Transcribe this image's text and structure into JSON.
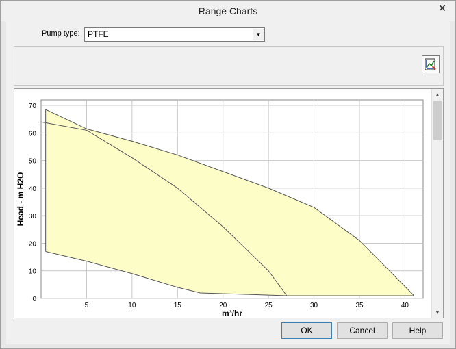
{
  "window": {
    "title": "Range Charts",
    "close_glyph": "✕"
  },
  "form": {
    "pump_type_label": "Pump type:",
    "pump_type_value": "PTFE"
  },
  "toolbar": {
    "chart_tool_icon": "chart-settings-icon"
  },
  "buttons": {
    "ok": "OK",
    "cancel": "Cancel",
    "help": "Help"
  },
  "chart_data": {
    "type": "area",
    "xlabel": "m³/hr",
    "ylabel": "Head - m H2O",
    "xlim": [
      0,
      42
    ],
    "ylim": [
      0,
      72
    ],
    "x_ticks": [
      5,
      10,
      15,
      20,
      25,
      30,
      35,
      40
    ],
    "y_ticks": [
      0,
      10,
      20,
      30,
      40,
      50,
      60,
      70
    ],
    "grid": true,
    "fill_color": "#fdfdc8",
    "line_color": "#555555",
    "series": [
      {
        "values": [
          [
            0.5,
            68.5
          ],
          [
            5,
            61.5
          ],
          [
            10,
            57
          ],
          [
            15,
            52
          ],
          [
            20,
            46
          ],
          [
            25,
            40
          ],
          [
            30,
            33
          ],
          [
            35,
            21
          ],
          [
            38,
            11
          ],
          [
            41,
            1
          ]
        ]
      },
      {
        "values": [
          [
            0,
            64
          ],
          [
            5,
            61
          ],
          [
            10,
            51
          ],
          [
            15,
            40
          ],
          [
            20,
            26
          ],
          [
            25,
            10
          ],
          [
            27,
            1
          ]
        ]
      },
      {
        "values": [
          [
            0.5,
            17
          ],
          [
            5,
            13.5
          ],
          [
            10,
            9
          ],
          [
            15,
            4
          ],
          [
            17.5,
            2
          ],
          [
            27,
            1
          ],
          [
            41,
            1
          ]
        ]
      }
    ]
  }
}
